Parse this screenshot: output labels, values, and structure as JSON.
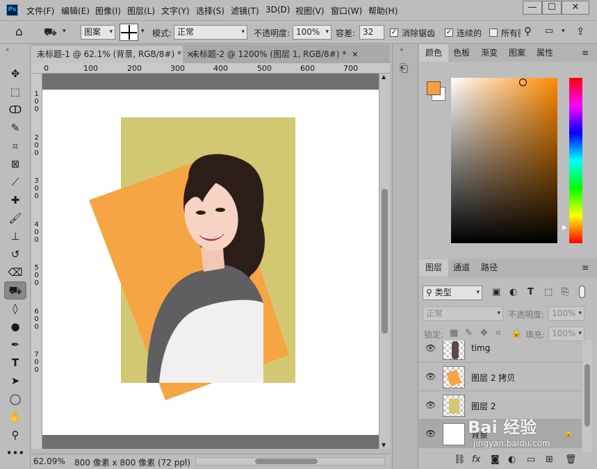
{
  "app": {
    "logo": "Ps"
  },
  "menu": [
    "文件(F)",
    "编辑(E)",
    "图像(I)",
    "图层(L)",
    "文字(Y)",
    "选择(S)",
    "滤镜(T)",
    "3D(D)",
    "视图(V)",
    "窗口(W)",
    "帮助(H)"
  ],
  "window_buttons": {
    "minimize": "—",
    "restore": "☐",
    "close": "✕"
  },
  "options": {
    "source": "图案",
    "mode_label": "模式:",
    "mode_value": "正常",
    "opacity_label": "不透明度:",
    "opacity_value": "100%",
    "tolerance_label": "容差:",
    "tolerance_value": "32",
    "antialias": "消除锯齿",
    "contiguous": "连续的",
    "all_layers": "所有图"
  },
  "tabs": [
    {
      "label": "未标题-1 @ 62.1% (背景, RGB/8#) *"
    },
    {
      "label": "未标题-2 @ 1200% (图层 1, RGB/8#) *"
    }
  ],
  "ruler_h": [
    "0",
    "100",
    "200",
    "300",
    "400",
    "500",
    "600",
    "700"
  ],
  "ruler_v": [
    "1",
    "0",
    "0",
    "2",
    "0",
    "0",
    "3",
    "0",
    "0",
    "4",
    "0",
    "0",
    "5",
    "0",
    "0",
    "6",
    "0",
    "0",
    "7",
    "0",
    "0"
  ],
  "status": {
    "zoom": "62.09%",
    "doc_info": "800 像素 x 800 像素 (72 ppi)"
  },
  "color_panel": {
    "tabs": [
      "颜色",
      "色板",
      "渐变",
      "图案",
      "属性"
    ],
    "foreground": "#f6a040",
    "background": "#ffffff"
  },
  "layers_panel": {
    "tabs": [
      "图层",
      "通道",
      "路径"
    ],
    "filter": "类型",
    "blend": "正常",
    "opacity_label": "不透明度:",
    "opacity_value": "100%",
    "lock_label": "锁定:",
    "fill_label": "填充:",
    "fill_value": "100%",
    "layers": [
      {
        "name": "timg",
        "thumb": "photo"
      },
      {
        "name": "图层 2 拷贝",
        "thumb": "orange"
      },
      {
        "name": "图层 2",
        "thumb": "olive"
      },
      {
        "name": "背景",
        "thumb": "white"
      }
    ]
  },
  "watermark": {
    "brand": "Bai  经验",
    "url": "jingyan.baidu.com"
  },
  "colors": {
    "olive": "#d2c872",
    "orange": "#f6a544",
    "canvas_bg": "#ffffff",
    "workspace": "#707070"
  }
}
